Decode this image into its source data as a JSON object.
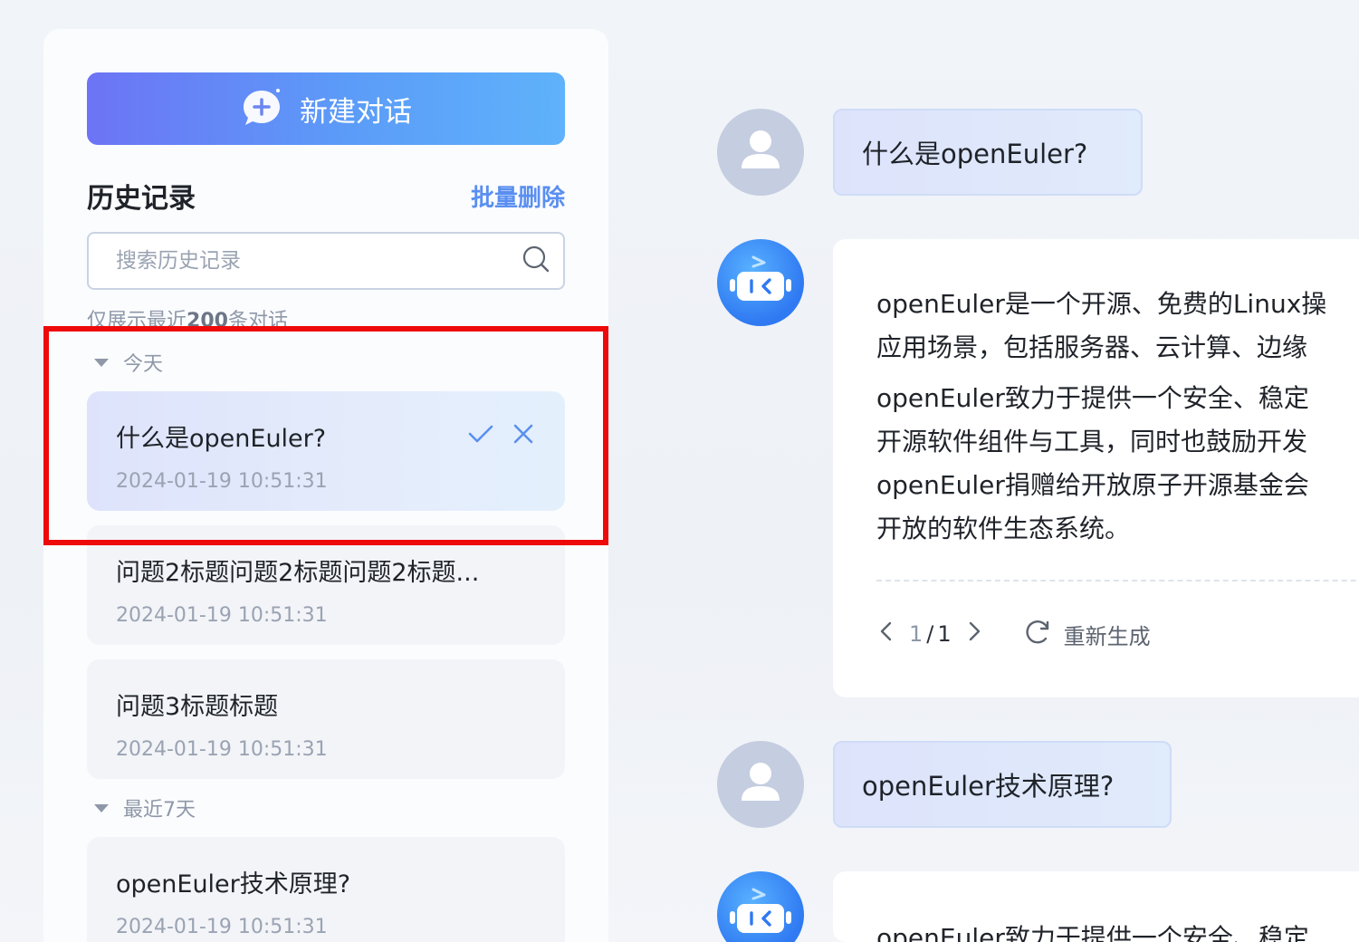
{
  "sidebar": {
    "new_chat_label": "新建对话",
    "history_title": "历史记录",
    "batch_delete_label": "批量删除",
    "search_placeholder": "搜索历史记录",
    "note_prefix": "仅展示最近",
    "note_count": "200",
    "note_suffix": "条对话",
    "groups": [
      {
        "label": "今天",
        "items": [
          {
            "title": "什么是openEuler?",
            "date": "2024-01-19 10:51:31"
          },
          {
            "title": "问题2标题问题2标题问题2标题...",
            "date": "2024-01-19 10:51:31"
          },
          {
            "title": "问题3标题标题",
            "date": "2024-01-19 10:51:31"
          }
        ]
      },
      {
        "label": "最近7天",
        "items": [
          {
            "title": "openEuler技术原理?",
            "date": "2024-01-19 10:51:31"
          }
        ]
      }
    ]
  },
  "chat": {
    "q1": "什么是openEuler?",
    "a1_lines": [
      "openEuler是一个开源、免费的Linux操",
      "应用场景，包括服务器、云计算、边缘",
      "openEuler致力于提供一个安全、稳定",
      "开源软件组件与工具，同时也鼓励开发",
      "openEuler捐赠给开放原子开源基金会",
      "开放的软件生态系统。"
    ],
    "a1_page_current": "1",
    "a1_page_sep": "/",
    "a1_page_total": "1",
    "regenerate_label": "重新生成",
    "q2": "openEuler技术原理?",
    "a2_first_line": "openEuler致力于提供一个安全、稳定"
  },
  "colors": {
    "accent": "#5a8ff0",
    "highlight_box": "#ee0a0a",
    "bot_avatar": "#2f79f2"
  }
}
